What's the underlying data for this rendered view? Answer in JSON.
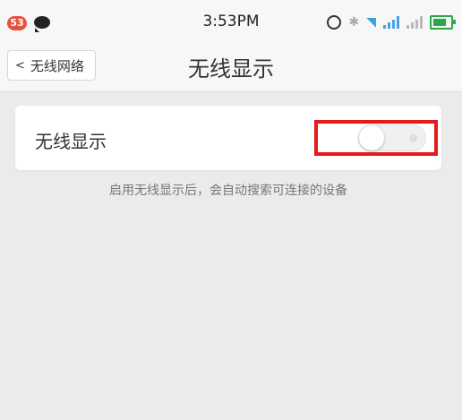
{
  "status_bar": {
    "notification_count": "53",
    "time": "3:53PM",
    "icons": [
      "chat-icon",
      "alarm-icon",
      "bluetooth-icon",
      "wifi-icon",
      "signal-icon",
      "signal-icon",
      "battery-icon"
    ]
  },
  "header": {
    "back_label": "无线网络",
    "title": "无线显示"
  },
  "setting": {
    "label": "无线显示",
    "toggle_on": false,
    "highlight_color": "#e31b1b"
  },
  "hint": "启用无线显示后，会自动搜索可连接的设备"
}
